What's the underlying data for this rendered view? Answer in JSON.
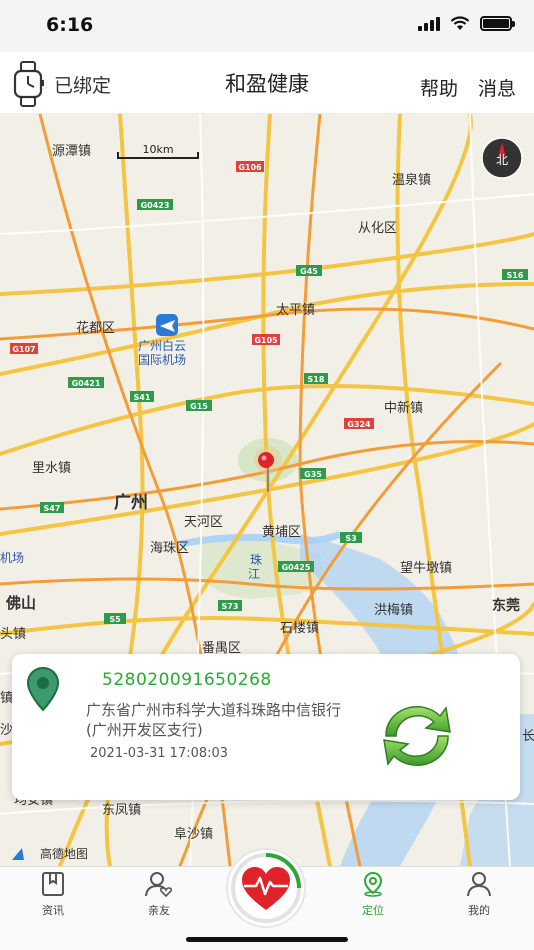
{
  "status_bar": {
    "time": "6:16"
  },
  "header": {
    "bind_status": "已绑定",
    "title": "和盈健康",
    "help": "帮助",
    "messages": "消息"
  },
  "map": {
    "scale_label": "10km",
    "compass_label": "北",
    "attribution": "高德地图",
    "places": [
      "源潭镇",
      "温泉镇",
      "从化区",
      "花都区",
      "太平镇",
      "广州白云",
      "国际机场",
      "中新镇",
      "里水镇",
      "广州",
      "天河区",
      "黄埔区",
      "海珠区",
      "机场",
      "珠",
      "江",
      "望牛墩镇",
      "佛山",
      "洪梅镇",
      "东莞",
      "石楼镇",
      "番禺区",
      "东凤镇",
      "阜沙镇",
      "均安镇",
      "长",
      "镇",
      "头镇",
      "沙镇"
    ],
    "roads": [
      "G106",
      "G0423",
      "G45",
      "S16",
      "G107",
      "G105",
      "G0421",
      "S41",
      "G15",
      "S18",
      "G324",
      "G35",
      "S47",
      "S3",
      "G0425",
      "S73",
      "S5"
    ]
  },
  "location_card": {
    "device_id": "528020091650268",
    "address": "广东省广州市科学大道科珠路中信银行(广州开发区支行)",
    "timestamp": "2021-03-31 17:08:03"
  },
  "tabs": [
    {
      "label": "资讯",
      "icon": "news-icon"
    },
    {
      "label": "亲友",
      "icon": "friends-icon"
    },
    {
      "label": "定位",
      "icon": "location-icon",
      "active": true
    },
    {
      "label": "我的",
      "icon": "profile-icon"
    }
  ],
  "colors": {
    "accent": "#2aa834",
    "pin": "#e0232a"
  }
}
